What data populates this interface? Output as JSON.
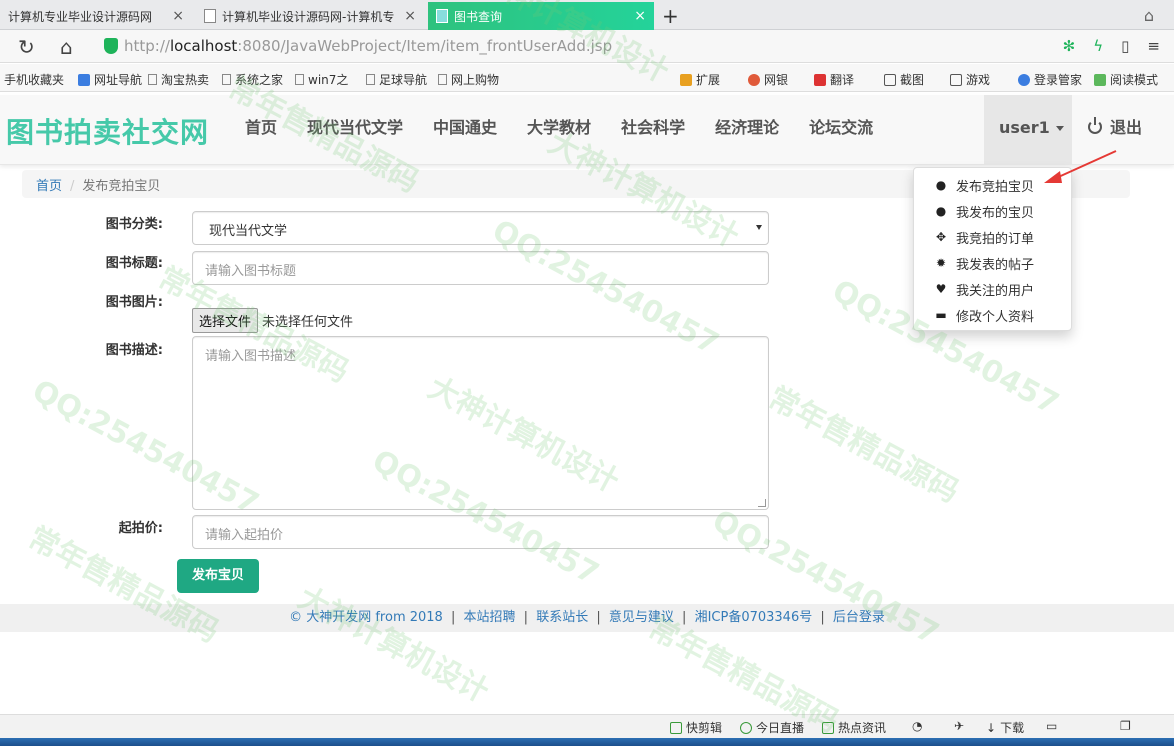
{
  "browser": {
    "tabs": [
      {
        "title": "计算机专业毕业设计源码网",
        "close": "×"
      },
      {
        "title": "计算机毕业设计源码网-计算机专",
        "close": "×"
      },
      {
        "title": "图书查询",
        "close": "×"
      }
    ],
    "new_tab": "+",
    "url_scheme": "http://",
    "url_host": "localhost",
    "url_rest": ":8080/JavaWebProject/Item/item_frontUserAdd.jsp",
    "bookmarks": [
      "手机收藏夹",
      "网址导航",
      "淘宝热卖",
      "系统之家",
      "win7之",
      "足球导航",
      "网上购物"
    ],
    "toolbar_right": [
      "扩展",
      "网银",
      "翻译",
      "截图",
      "游戏",
      "登录管家",
      "阅读模式"
    ]
  },
  "site": {
    "brand": "图书拍卖社交网",
    "nav": [
      "首页",
      "现代当代文学",
      "中国通史",
      "大学教材",
      "社会科学",
      "经济理论",
      "论坛交流"
    ],
    "user": "user1",
    "logout": "退出",
    "user_dropdown": [
      {
        "label": "发布竞拍宝贝",
        "icon": "user-icon"
      },
      {
        "label": "我发布的宝贝",
        "icon": "user-icon"
      },
      {
        "label": "我竞拍的订单",
        "icon": "move-icon"
      },
      {
        "label": "我发表的帖子",
        "icon": "gear-icon"
      },
      {
        "label": "我关注的用户",
        "icon": "heart-icon"
      },
      {
        "label": "修改个人资料",
        "icon": "credit-card-icon"
      }
    ]
  },
  "breadcrumb": {
    "home": "首页",
    "sep": "/",
    "current": "发布竞拍宝贝"
  },
  "form": {
    "category_label": "图书分类:",
    "category_value": "现代当代文学",
    "title_label": "图书标题:",
    "title_placeholder": "请输入图书标题",
    "image_label": "图书图片:",
    "file_button": "选择文件",
    "file_status": "未选择任何文件",
    "desc_label": "图书描述:",
    "desc_placeholder": "请输入图书描述",
    "price_label": "起拍价:",
    "price_placeholder": "请输入起拍价",
    "submit": "发布宝贝"
  },
  "footer": {
    "copyright": "© 大神开发网 from 2018",
    "links": [
      "本站招聘",
      "联系站长",
      "意见与建议",
      "湘ICP备0703346号",
      "后台登录"
    ],
    "sep": "|"
  },
  "statusbar": [
    "快剪辑",
    "今日直播",
    "热点资讯",
    "下载"
  ],
  "watermarks": [
    "QQ:254540457",
    "大神计算机设计",
    "常年售精品源码"
  ]
}
